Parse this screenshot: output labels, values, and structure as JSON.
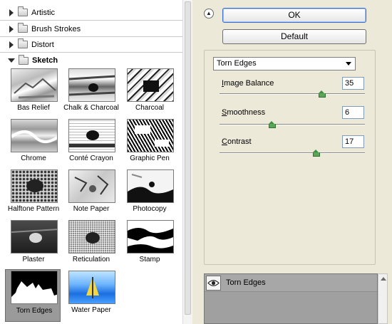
{
  "gallery": {
    "categories": [
      {
        "label": "Artistic"
      },
      {
        "label": "Brush Strokes"
      },
      {
        "label": "Distort"
      },
      {
        "label": "Sketch"
      }
    ],
    "filters": [
      {
        "label": "Bas Relief"
      },
      {
        "label": "Chalk & Charcoal"
      },
      {
        "label": "Charcoal"
      },
      {
        "label": "Chrome"
      },
      {
        "label": "Conté Crayon"
      },
      {
        "label": "Graphic Pen"
      },
      {
        "label": "Halftone Pattern"
      },
      {
        "label": "Note Paper"
      },
      {
        "label": "Photocopy"
      },
      {
        "label": "Plaster"
      },
      {
        "label": "Reticulation"
      },
      {
        "label": "Stamp"
      },
      {
        "label": "Torn Edges"
      },
      {
        "label": "Water Paper"
      }
    ],
    "selected_filter": "Torn Edges"
  },
  "buttons": {
    "ok": "OK",
    "default": "Default"
  },
  "filter_select": {
    "value": "Torn Edges"
  },
  "params": [
    {
      "label_pre": "",
      "label_u": "I",
      "label_post": "mage Balance",
      "value": "35",
      "level": 0.7
    },
    {
      "label_pre": "",
      "label_u": "S",
      "label_post": "moothness",
      "value": "6",
      "level": 0.36
    },
    {
      "label_pre": "",
      "label_u": "C",
      "label_post": "ontrast",
      "value": "17",
      "level": 0.66
    }
  ],
  "layers": {
    "items": [
      {
        "label": "Torn Edges"
      }
    ]
  },
  "colors": {
    "dialog_bg": "#ece9d8",
    "knob": "#5aa55a",
    "selected_tile": "#9a9a9a"
  }
}
